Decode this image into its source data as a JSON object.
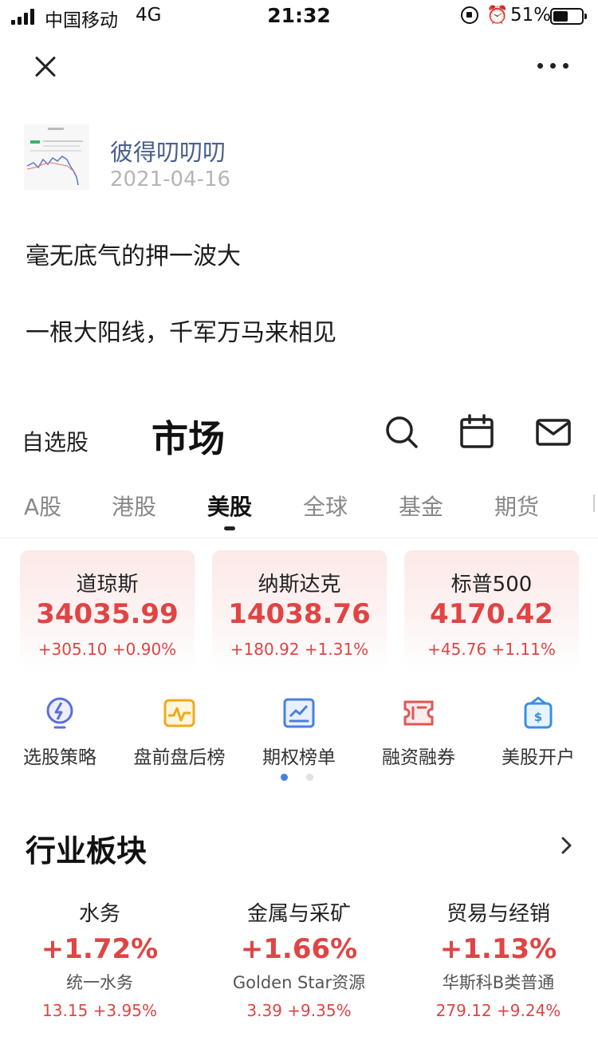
{
  "status_bar": {
    "carrier": "中国移动",
    "network": "4G",
    "time": "21:32",
    "battery": "51%"
  },
  "nav": {
    "close_icon": "close-icon",
    "more_icon": "more-horizontal-icon"
  },
  "post": {
    "author": "彼得叨叨叨",
    "date": "2021-04-16",
    "lines": [
      "毫无底气的押一波大",
      "一根大阳线，千军万马来相见"
    ]
  },
  "market": {
    "watchlist_tab": "自选股",
    "title": "市场",
    "icons": [
      "search-icon",
      "calendar-icon",
      "mail-icon"
    ]
  },
  "subtabs": [
    {
      "label": "A股",
      "active": false
    },
    {
      "label": "港股",
      "active": false
    },
    {
      "label": "美股",
      "active": true
    },
    {
      "label": "全球",
      "active": false
    },
    {
      "label": "基金",
      "active": false
    },
    {
      "label": "期货",
      "active": false
    }
  ],
  "indices": [
    {
      "name": "道琼斯",
      "value": "34035.99",
      "change": "+305.10 +0.90%"
    },
    {
      "name": "纳斯达克",
      "value": "14038.76",
      "change": "+180.92 +1.31%"
    },
    {
      "name": "标普500",
      "value": "4170.42",
      "change": "+45.76 +1.11%"
    }
  ],
  "quick_menu": [
    {
      "label": "选股策略",
      "icon": "lightbulb-icon"
    },
    {
      "label": "盘前盘后榜",
      "icon": "pulse-icon"
    },
    {
      "label": "期权榜单",
      "icon": "chart-icon"
    },
    {
      "label": "融资融券",
      "icon": "ticket-icon"
    },
    {
      "label": "美股开户",
      "icon": "wallet-icon"
    }
  ],
  "pager": {
    "count": 2,
    "active": 0
  },
  "sector_section": {
    "title": "行业板块",
    "more_icon": "chevron-right-icon",
    "items": [
      {
        "name": "水务",
        "pct": "+1.72%",
        "stock": "统一水务",
        "price": "13.15 +3.95%"
      },
      {
        "name": "金属与采矿",
        "pct": "+1.66%",
        "stock": "Golden Star资源",
        "price": "3.39 +9.35%"
      },
      {
        "name": "贸易与经销",
        "pct": "+1.13%",
        "stock": "华斯科B类普通",
        "price": "279.12 +9.24%"
      }
    ]
  },
  "colors": {
    "up": "#e04444",
    "author": "#4a5f8b",
    "accent_blue": "#4a7fe0",
    "card_bg": "#fde9e9"
  }
}
